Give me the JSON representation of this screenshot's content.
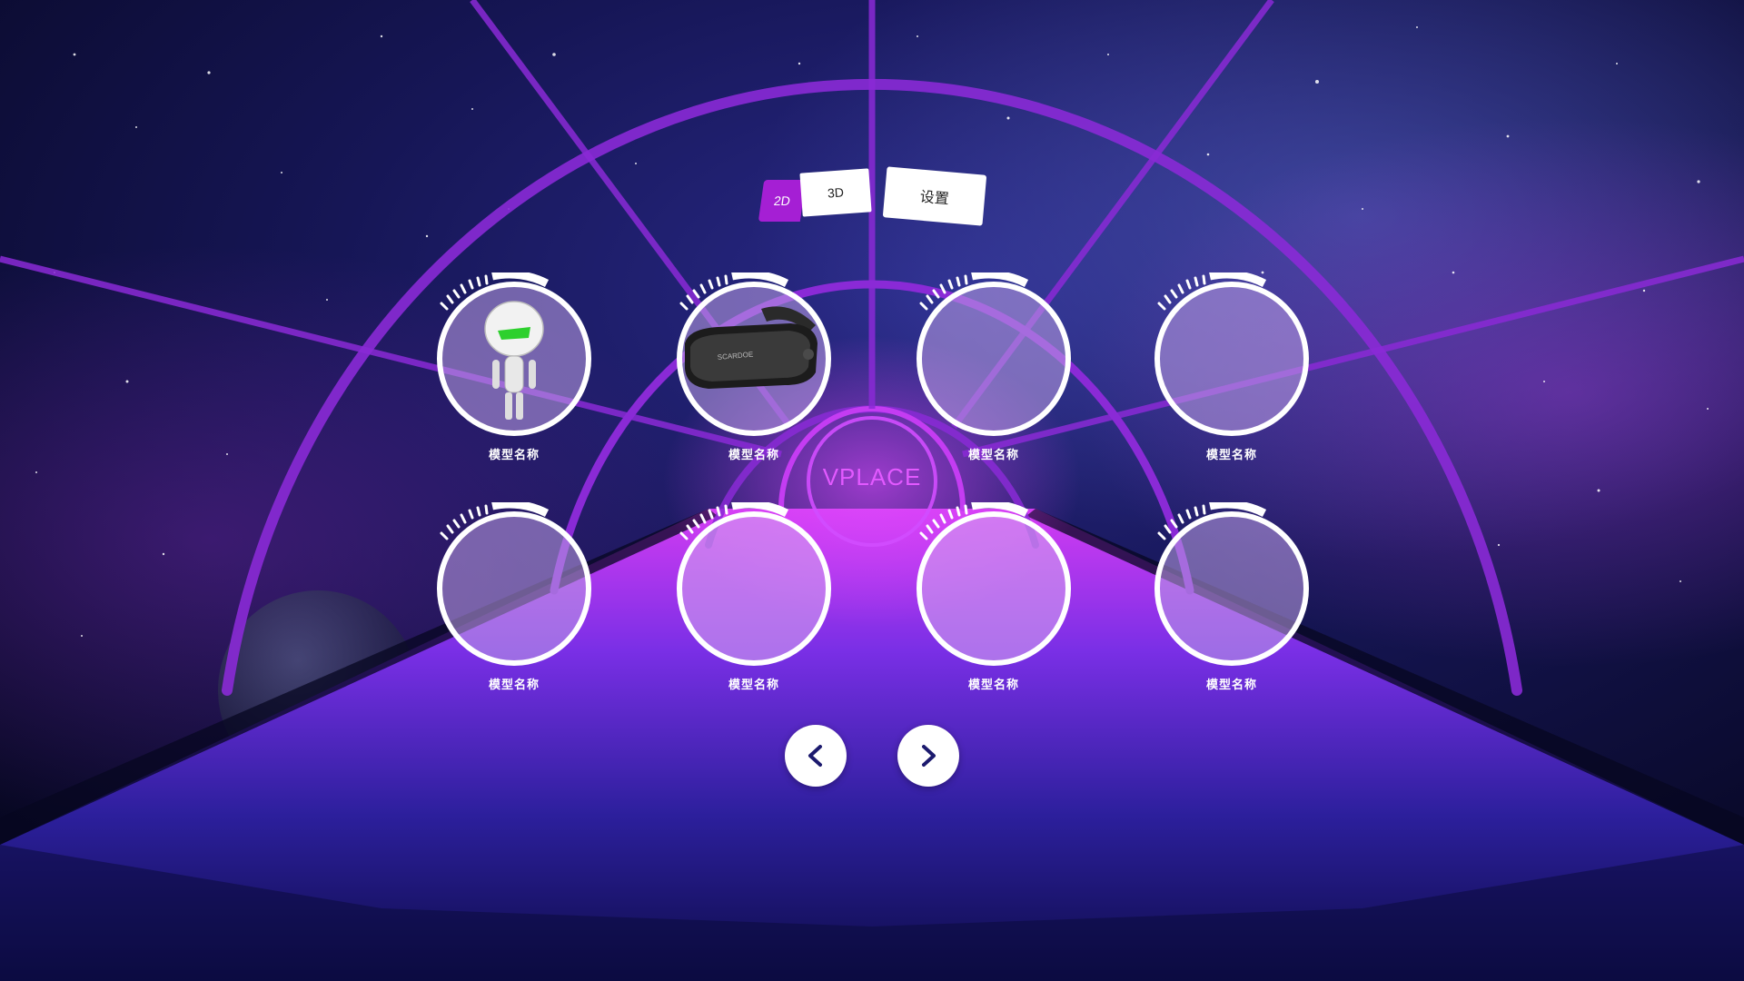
{
  "app": {
    "logo_text": "VPLACE"
  },
  "mode_tabs": {
    "tab_2d": "2D",
    "tab_3d": "3D",
    "settings": "设置",
    "active": "2D"
  },
  "models": [
    {
      "name": "模型名称",
      "thumbnail": "robot-icon"
    },
    {
      "name": "模型名称",
      "thumbnail": "vr-headset-icon"
    },
    {
      "name": "模型名称",
      "thumbnail": ""
    },
    {
      "name": "模型名称",
      "thumbnail": ""
    },
    {
      "name": "模型名称",
      "thumbnail": ""
    },
    {
      "name": "模型名称",
      "thumbnail": ""
    },
    {
      "name": "模型名称",
      "thumbnail": ""
    },
    {
      "name": "模型名称",
      "thumbnail": ""
    }
  ],
  "navigation": {
    "prev_icon": "chevron-left-icon",
    "next_icon": "chevron-right-icon"
  },
  "colors": {
    "accent_purple": "#a51fd4",
    "logo_magenta": "#e259ff",
    "background_deep": "#0b0a2e",
    "floor_violet": "#6a2be0"
  }
}
